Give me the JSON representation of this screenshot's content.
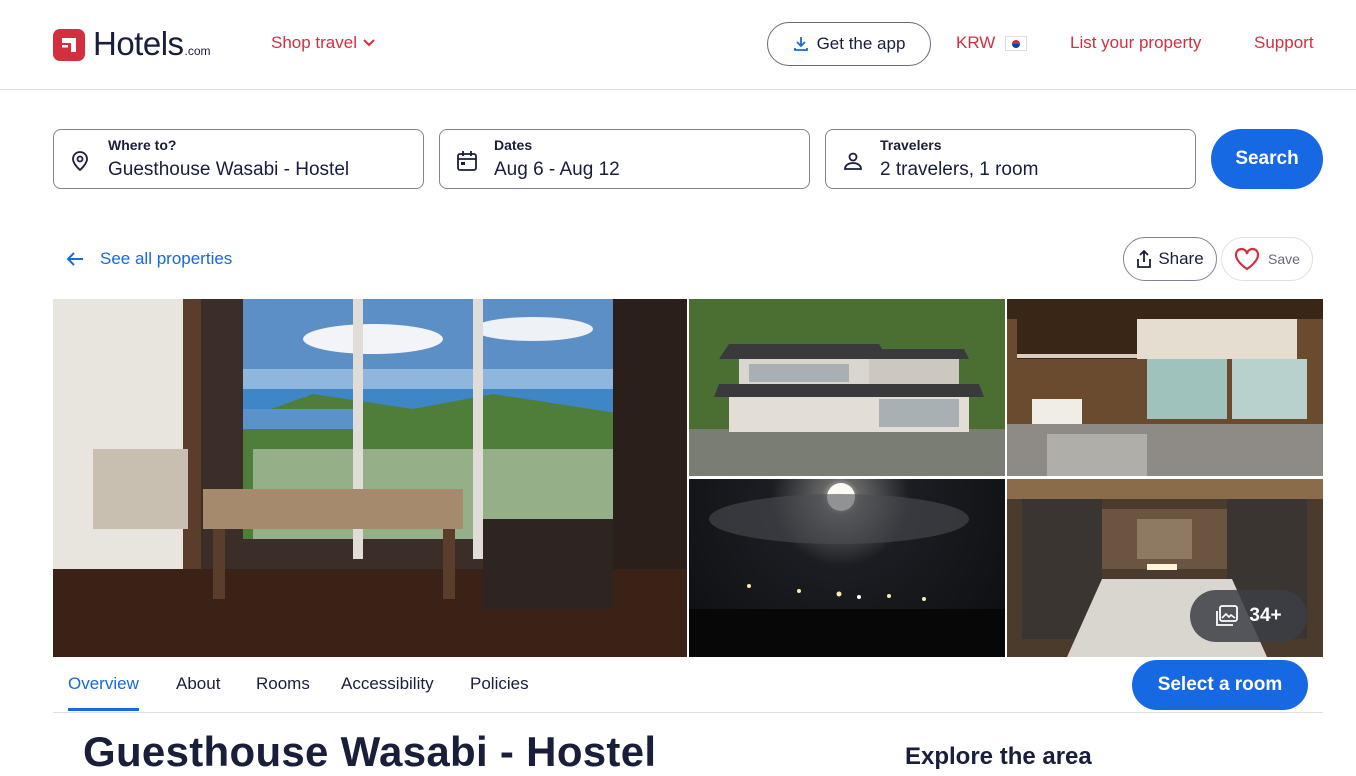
{
  "header": {
    "logo_text": "Hotels",
    "logo_suffix": ".com",
    "shop_travel": "Shop travel",
    "get_app": "Get the app",
    "currency": "KRW",
    "list_property": "List your property",
    "support": "Support"
  },
  "search": {
    "destination_label": "Where to?",
    "destination_value": "Guesthouse Wasabi - Hostel",
    "dates_label": "Dates",
    "dates_value": "Aug 6 - Aug 12",
    "travelers_label": "Travelers",
    "travelers_value": "2 travelers, 1 room",
    "button": "Search"
  },
  "nav": {
    "back_label": "See all properties",
    "share_label": "Share",
    "save_label": "Save"
  },
  "gallery": {
    "more_count": "34+"
  },
  "tabs": [
    {
      "label": "Overview",
      "active": true
    },
    {
      "label": "About",
      "active": false
    },
    {
      "label": "Rooms",
      "active": false
    },
    {
      "label": "Accessibility",
      "active": false
    },
    {
      "label": "Policies",
      "active": false
    }
  ],
  "select_room": "Select a room",
  "property": {
    "title": "Guesthouse Wasabi - Hostel",
    "explore_heading": "Explore the area"
  },
  "colors": {
    "brand_red": "#d32f3f",
    "primary_blue": "#1668e3",
    "text_dark": "#191e3b"
  }
}
